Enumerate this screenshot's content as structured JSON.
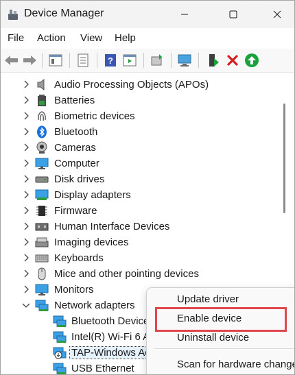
{
  "window": {
    "title": "Device Manager"
  },
  "menubar": {
    "items": [
      "File",
      "Action",
      "View",
      "Help"
    ]
  },
  "tree": {
    "categories": [
      {
        "label": "Audio Processing Objects (APOs)",
        "icon": "speaker-icon"
      },
      {
        "label": "Batteries",
        "icon": "battery-icon"
      },
      {
        "label": "Biometric devices",
        "icon": "fingerprint-icon"
      },
      {
        "label": "Bluetooth",
        "icon": "bluetooth-icon"
      },
      {
        "label": "Cameras",
        "icon": "camera-icon"
      },
      {
        "label": "Computer",
        "icon": "monitor-icon"
      },
      {
        "label": "Disk drives",
        "icon": "disk-drive-icon"
      },
      {
        "label": "Display adapters",
        "icon": "display-adapter-icon"
      },
      {
        "label": "Firmware",
        "icon": "chip-icon"
      },
      {
        "label": "Human Interface Devices",
        "icon": "hid-icon"
      },
      {
        "label": "Imaging devices",
        "icon": "scanner-icon"
      },
      {
        "label": "Keyboards",
        "icon": "keyboard-icon"
      },
      {
        "label": "Mice and other pointing devices",
        "icon": "mouse-icon"
      },
      {
        "label": "Monitors",
        "icon": "monitor-icon"
      },
      {
        "label": "Network adapters",
        "icon": "network-adapter-icon"
      }
    ],
    "network_children": [
      {
        "label": "Bluetooth Device",
        "icon": "network-adapter-icon"
      },
      {
        "label": "Intel(R) Wi-Fi 6 A",
        "icon": "network-adapter-icon"
      },
      {
        "label": "TAP-Windows Ac",
        "icon": "disabled-network-adapter-icon"
      },
      {
        "label": "USB Ethernet",
        "icon": "network-adapter-icon"
      }
    ]
  },
  "context_menu": {
    "update_driver": "Update driver",
    "enable_device": "Enable device",
    "uninstall_device": "Uninstall device",
    "scan": "Scan for hardware changes"
  },
  "colors": {
    "highlight": "#e0474c",
    "accent_green": "#1aa23a",
    "delete_red": "#d21f1f"
  }
}
